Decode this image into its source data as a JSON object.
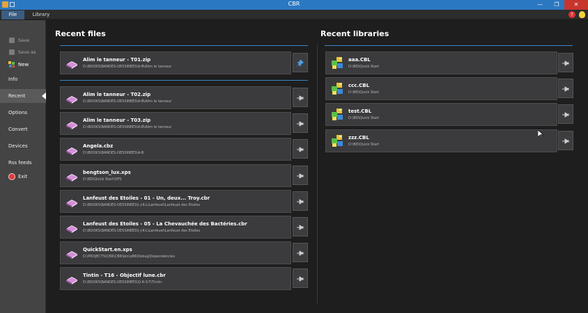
{
  "window": {
    "title": "CBR",
    "controls": {
      "minimize": "—",
      "maximize": "❐",
      "close": "✕"
    }
  },
  "menu": {
    "tabs": [
      "File",
      "Library"
    ]
  },
  "sidebar": {
    "save": "Save",
    "save_as": "Save as",
    "new": "New",
    "info": "Info",
    "recent": "Recent",
    "options": "Options",
    "convert": "Convert",
    "devices": "Devices",
    "rss": "Rss feeds",
    "exit": "Exit"
  },
  "recent_files": {
    "title": "Recent files",
    "pinned": [
      {
        "name": "Alim le tanneur - T01.zip",
        "path": "D:\\BOOKS\\BANDES-DESSINEES\\A-B\\Alim le tanneur"
      }
    ],
    "items": [
      {
        "name": "Alim le tanneur - T02.zip",
        "path": "D:\\BOOKS\\BANDES-DESSINEES\\A-B\\Alim le tanneur"
      },
      {
        "name": "Alim le tanneur - T03.zip",
        "path": "D:\\BOOKS\\BANDES-DESSINEES\\A-B\\Alim le tanneur"
      },
      {
        "name": "Angela.cbz",
        "path": "D:\\BOOKS\\BANDES-DESSINEES\\A-B"
      },
      {
        "name": "bengtson_lux.xps",
        "path": "D:\\BD\\Quick Start\\XPS"
      },
      {
        "name": "Lanfeust des Etoiles - 01 - Un, deux... Troy.cbr",
        "path": "D:\\BOOKS\\BANDES-DESSINEES\\I-J-K-L\\Lanfeust\\Lanfeust des Etoiles"
      },
      {
        "name": "Lanfeust des Etoiles - 05 - La Chevauchée des Bactéries.cbr",
        "path": "D:\\BOOKS\\BANDES-DESSINEES\\I-J-K-L\\Lanfeust\\Lanfeust des Etoiles"
      },
      {
        "name": "QuickStart.en.xps",
        "path": "D:\\PROJECTS\\CBR\\CBR\\bin\\x86\\Debug\\Dependencies"
      },
      {
        "name": "Tintin - T16 - Objectif lune.cbr",
        "path": "D:\\BOOKS\\BANDES-DESSINEES\\Q-R-S-T\\Tintin"
      }
    ]
  },
  "recent_libraries": {
    "title": "Recent libraries",
    "items": [
      {
        "name": "aaa.CBL",
        "path": "D:\\BD\\Quick Start"
      },
      {
        "name": "ccc.CBL",
        "path": "D:\\BD\\Quick Start"
      },
      {
        "name": "test.CBL",
        "path": "D:\\BD\\Quick Start"
      },
      {
        "name": "zzz.CBL",
        "path": "D:\\BD\\Quick Start"
      }
    ]
  },
  "colors": {
    "accent": "#3b86c8",
    "titlebar": "#2b78c2",
    "item_bg": "#3b3b3d"
  }
}
